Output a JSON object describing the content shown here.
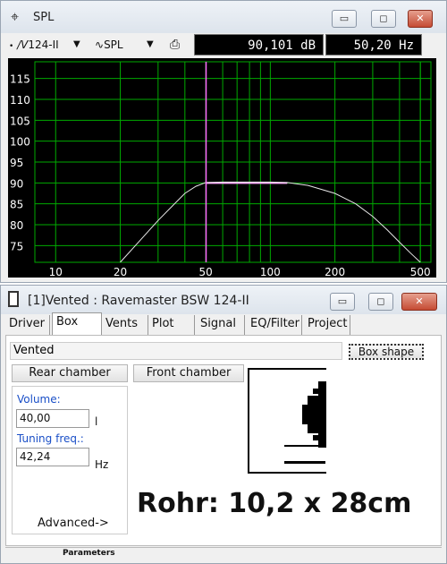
{
  "spl_window": {
    "title": "SPL",
    "minimize": "▭",
    "maximize": "◻",
    "close": "✕",
    "driver_select": "124-II",
    "curve_select": "SPL",
    "print_icon": "printer-icon",
    "readout_db": "90,101 dB",
    "readout_hz": "50,20 Hz"
  },
  "chart_data": {
    "type": "line",
    "x_scale": "log",
    "xlim": [
      8,
      560
    ],
    "ylim": [
      71,
      119
    ],
    "x_ticks": [
      "10",
      "20",
      "50",
      "100",
      "200",
      "500"
    ],
    "y_ticks": [
      "115",
      "110",
      "105",
      "100",
      "95",
      "90",
      "85",
      "80",
      "75"
    ],
    "grid": true,
    "cursor_x": 50.2,
    "colors": {
      "background": "#000000",
      "grid": "#00aa00",
      "curve": "#e6e6e6",
      "cursor": "#ff66ff",
      "ref": "#ffaaff"
    },
    "series": [
      {
        "x": [
          20,
          25,
          30,
          35,
          40,
          45,
          50,
          60,
          80,
          100,
          120,
          150,
          200,
          250,
          300,
          350,
          400,
          450,
          500
        ],
        "y": [
          71,
          76.5,
          81,
          84.5,
          87.5,
          89.2,
          90.1,
          90.2,
          90.2,
          90.2,
          90.1,
          89.4,
          87.5,
          85,
          82,
          78.8,
          75.8,
          73.2,
          71
        ]
      }
    ],
    "ref_line": {
      "x": [
        50,
        120
      ],
      "y": [
        90,
        90
      ]
    }
  },
  "box_window": {
    "title": "[1]Vented : Ravemaster BSW 124-II",
    "minimize": "▭",
    "maximize": "◻",
    "close": "✕",
    "tabs": [
      "Driver",
      "Box",
      "Vents",
      "Plot",
      "Signal",
      "EQ/Filter",
      "Project"
    ],
    "active_tab": "Box",
    "box_type": "Vented",
    "box_shape_label": "Box shape",
    "rear_chamber": "Rear chamber",
    "front_chamber": "Front chamber",
    "volume_label": "Volume:",
    "volume_value": "40,00",
    "volume_unit": "l",
    "tuning_label": "Tuning freq.:",
    "tuning_value": "42,24",
    "tuning_unit": "Hz",
    "advanced_label": "Advanced->",
    "annotation": "Rohr: 10,2 x 28cm",
    "status": "Parameters"
  }
}
